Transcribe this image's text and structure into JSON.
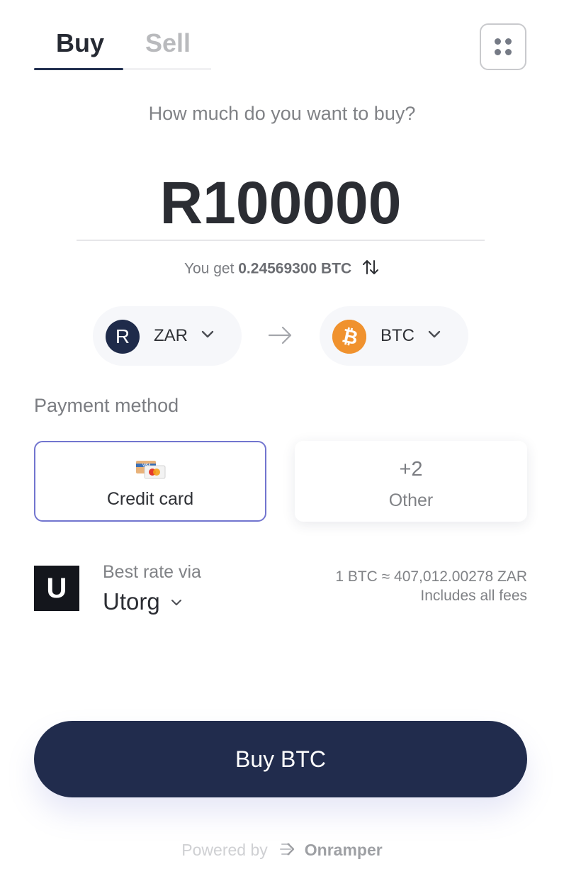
{
  "tabs": {
    "buy": "Buy",
    "sell": "Sell",
    "active": "Buy"
  },
  "question": "How much do you want to buy?",
  "amount": "R100000",
  "you_get": {
    "prefix": "You get",
    "value": "0.24569300 BTC"
  },
  "from_currency": {
    "code": "ZAR",
    "badge": "R",
    "icon": "rand-icon",
    "color": "#1f2b4a"
  },
  "to_currency": {
    "code": "BTC",
    "icon": "bitcoin-icon",
    "color": "#f0922e"
  },
  "payment": {
    "label": "Payment method",
    "selected": {
      "label": "Credit card",
      "icon": "credit-card-icon"
    },
    "other": {
      "count": "+2",
      "label": "Other"
    }
  },
  "provider": {
    "logo_letter": "U",
    "best_rate_label": "Best rate via",
    "name": "Utorg",
    "rate": "1 BTC ≈ 407,012.00278 ZAR",
    "fees_note": "Includes all fees"
  },
  "cta": {
    "label": "Buy BTC",
    "color": "#212c4d"
  },
  "footer": {
    "powered_by": "Powered by",
    "brand": "Onramper"
  },
  "accent_color": "#7275cf"
}
